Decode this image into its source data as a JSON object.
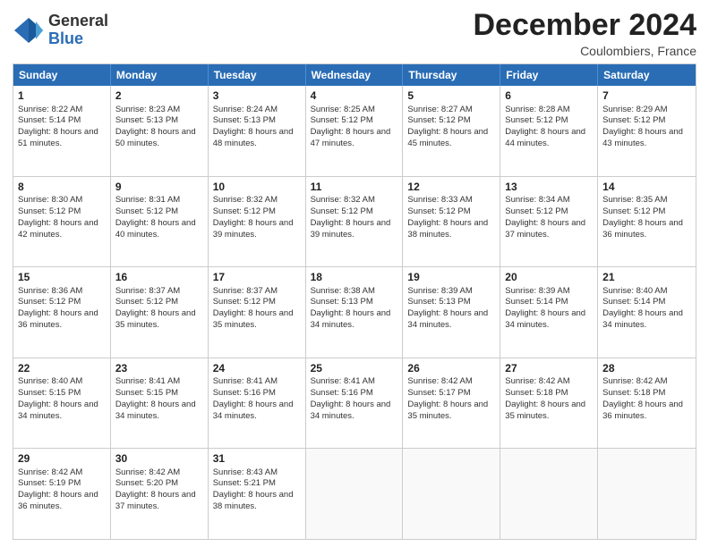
{
  "logo": {
    "general": "General",
    "blue": "Blue"
  },
  "title": "December 2024",
  "location": "Coulombiers, France",
  "days": [
    "Sunday",
    "Monday",
    "Tuesday",
    "Wednesday",
    "Thursday",
    "Friday",
    "Saturday"
  ],
  "weeks": [
    [
      {
        "day": 1,
        "sr": "8:22 AM",
        "ss": "5:14 PM",
        "dl": "8 hours and 51 minutes."
      },
      {
        "day": 2,
        "sr": "8:23 AM",
        "ss": "5:13 PM",
        "dl": "8 hours and 50 minutes."
      },
      {
        "day": 3,
        "sr": "8:24 AM",
        "ss": "5:13 PM",
        "dl": "8 hours and 48 minutes."
      },
      {
        "day": 4,
        "sr": "8:25 AM",
        "ss": "5:12 PM",
        "dl": "8 hours and 47 minutes."
      },
      {
        "day": 5,
        "sr": "8:27 AM",
        "ss": "5:12 PM",
        "dl": "8 hours and 45 minutes."
      },
      {
        "day": 6,
        "sr": "8:28 AM",
        "ss": "5:12 PM",
        "dl": "8 hours and 44 minutes."
      },
      {
        "day": 7,
        "sr": "8:29 AM",
        "ss": "5:12 PM",
        "dl": "8 hours and 43 minutes."
      }
    ],
    [
      {
        "day": 8,
        "sr": "8:30 AM",
        "ss": "5:12 PM",
        "dl": "8 hours and 42 minutes."
      },
      {
        "day": 9,
        "sr": "8:31 AM",
        "ss": "5:12 PM",
        "dl": "8 hours and 40 minutes."
      },
      {
        "day": 10,
        "sr": "8:32 AM",
        "ss": "5:12 PM",
        "dl": "8 hours and 39 minutes."
      },
      {
        "day": 11,
        "sr": "8:32 AM",
        "ss": "5:12 PM",
        "dl": "8 hours and 39 minutes."
      },
      {
        "day": 12,
        "sr": "8:33 AM",
        "ss": "5:12 PM",
        "dl": "8 hours and 38 minutes."
      },
      {
        "day": 13,
        "sr": "8:34 AM",
        "ss": "5:12 PM",
        "dl": "8 hours and 37 minutes."
      },
      {
        "day": 14,
        "sr": "8:35 AM",
        "ss": "5:12 PM",
        "dl": "8 hours and 36 minutes."
      }
    ],
    [
      {
        "day": 15,
        "sr": "8:36 AM",
        "ss": "5:12 PM",
        "dl": "8 hours and 36 minutes."
      },
      {
        "day": 16,
        "sr": "8:37 AM",
        "ss": "5:12 PM",
        "dl": "8 hours and 35 minutes."
      },
      {
        "day": 17,
        "sr": "8:37 AM",
        "ss": "5:12 PM",
        "dl": "8 hours and 35 minutes."
      },
      {
        "day": 18,
        "sr": "8:38 AM",
        "ss": "5:13 PM",
        "dl": "8 hours and 34 minutes."
      },
      {
        "day": 19,
        "sr": "8:39 AM",
        "ss": "5:13 PM",
        "dl": "8 hours and 34 minutes."
      },
      {
        "day": 20,
        "sr": "8:39 AM",
        "ss": "5:14 PM",
        "dl": "8 hours and 34 minutes."
      },
      {
        "day": 21,
        "sr": "8:40 AM",
        "ss": "5:14 PM",
        "dl": "8 hours and 34 minutes."
      }
    ],
    [
      {
        "day": 22,
        "sr": "8:40 AM",
        "ss": "5:15 PM",
        "dl": "8 hours and 34 minutes."
      },
      {
        "day": 23,
        "sr": "8:41 AM",
        "ss": "5:15 PM",
        "dl": "8 hours and 34 minutes."
      },
      {
        "day": 24,
        "sr": "8:41 AM",
        "ss": "5:16 PM",
        "dl": "8 hours and 34 minutes."
      },
      {
        "day": 25,
        "sr": "8:41 AM",
        "ss": "5:16 PM",
        "dl": "8 hours and 34 minutes."
      },
      {
        "day": 26,
        "sr": "8:42 AM",
        "ss": "5:17 PM",
        "dl": "8 hours and 35 minutes."
      },
      {
        "day": 27,
        "sr": "8:42 AM",
        "ss": "5:18 PM",
        "dl": "8 hours and 35 minutes."
      },
      {
        "day": 28,
        "sr": "8:42 AM",
        "ss": "5:18 PM",
        "dl": "8 hours and 36 minutes."
      }
    ],
    [
      {
        "day": 29,
        "sr": "8:42 AM",
        "ss": "5:19 PM",
        "dl": "8 hours and 36 minutes."
      },
      {
        "day": 30,
        "sr": "8:42 AM",
        "ss": "5:20 PM",
        "dl": "8 hours and 37 minutes."
      },
      {
        "day": 31,
        "sr": "8:43 AM",
        "ss": "5:21 PM",
        "dl": "8 hours and 38 minutes."
      },
      null,
      null,
      null,
      null
    ]
  ],
  "labels": {
    "sunrise": "Sunrise:",
    "sunset": "Sunset:",
    "daylight": "Daylight:"
  }
}
